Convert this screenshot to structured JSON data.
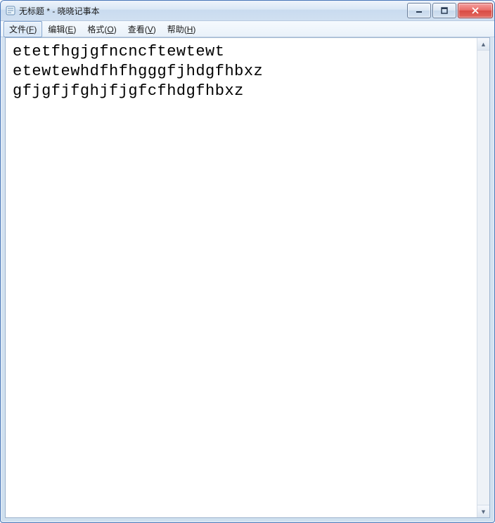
{
  "window": {
    "title": "无标题 * - 晓晓记事本"
  },
  "menubar": {
    "items": [
      {
        "label_pre": "文件(",
        "underline": "F",
        "label_post": ")",
        "selected": true
      },
      {
        "label_pre": "编辑(",
        "underline": "E",
        "label_post": ")",
        "selected": false
      },
      {
        "label_pre": "格式(",
        "underline": "O",
        "label_post": ")",
        "selected": false
      },
      {
        "label_pre": "查看(",
        "underline": "V",
        "label_post": ")",
        "selected": false
      },
      {
        "label_pre": "帮助(",
        "underline": "H",
        "label_post": ")",
        "selected": false
      }
    ]
  },
  "editor": {
    "content": "etetfhgjgfncncftewtewt\netewtewhdfhfhgggfjhdgfhbxz\ngfjgfjfghjfjgfcfhdgfhbxz"
  },
  "controls": {
    "minimize": "minimize",
    "maximize": "maximize",
    "close": "close"
  }
}
